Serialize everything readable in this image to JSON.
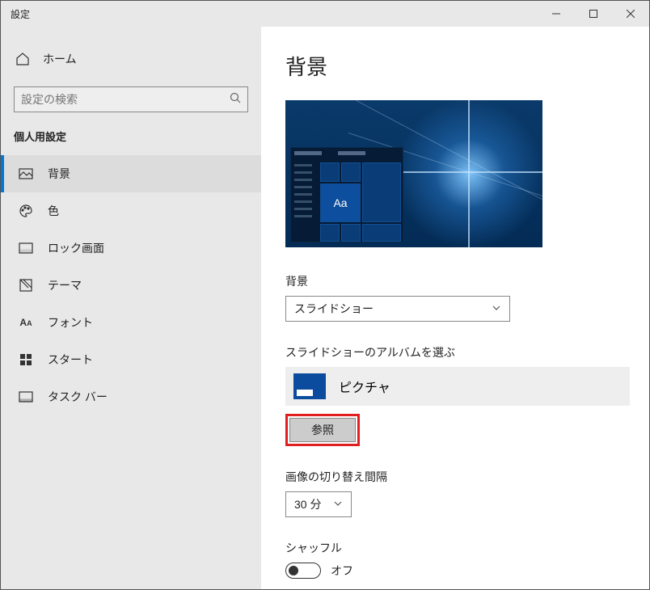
{
  "window": {
    "title": "設定"
  },
  "sidebar": {
    "home": "ホーム",
    "searchPlaceholder": "設定の検索",
    "section": "個人用設定",
    "items": [
      {
        "label": "背景",
        "active": true,
        "icon": "image"
      },
      {
        "label": "色",
        "active": false,
        "icon": "palette"
      },
      {
        "label": "ロック画面",
        "active": false,
        "icon": "lockscreen"
      },
      {
        "label": "テーマ",
        "active": false,
        "icon": "theme"
      },
      {
        "label": "フォント",
        "active": false,
        "icon": "font"
      },
      {
        "label": "スタート",
        "active": false,
        "icon": "start"
      },
      {
        "label": "タスク バー",
        "active": false,
        "icon": "taskbar"
      }
    ]
  },
  "main": {
    "heading": "背景",
    "preview": {
      "tileSample": "Aa"
    },
    "backgroundLabel": "背景",
    "backgroundValue": "スライドショー",
    "albumLabel": "スライドショーのアルバムを選ぶ",
    "albumName": "ピクチャ",
    "browse": "参照",
    "intervalLabel": "画像の切り替え間隔",
    "intervalValue": "30 分",
    "shuffleLabel": "シャッフル",
    "shuffleValue": "オフ"
  },
  "highlight": {
    "target": "browse-button"
  }
}
